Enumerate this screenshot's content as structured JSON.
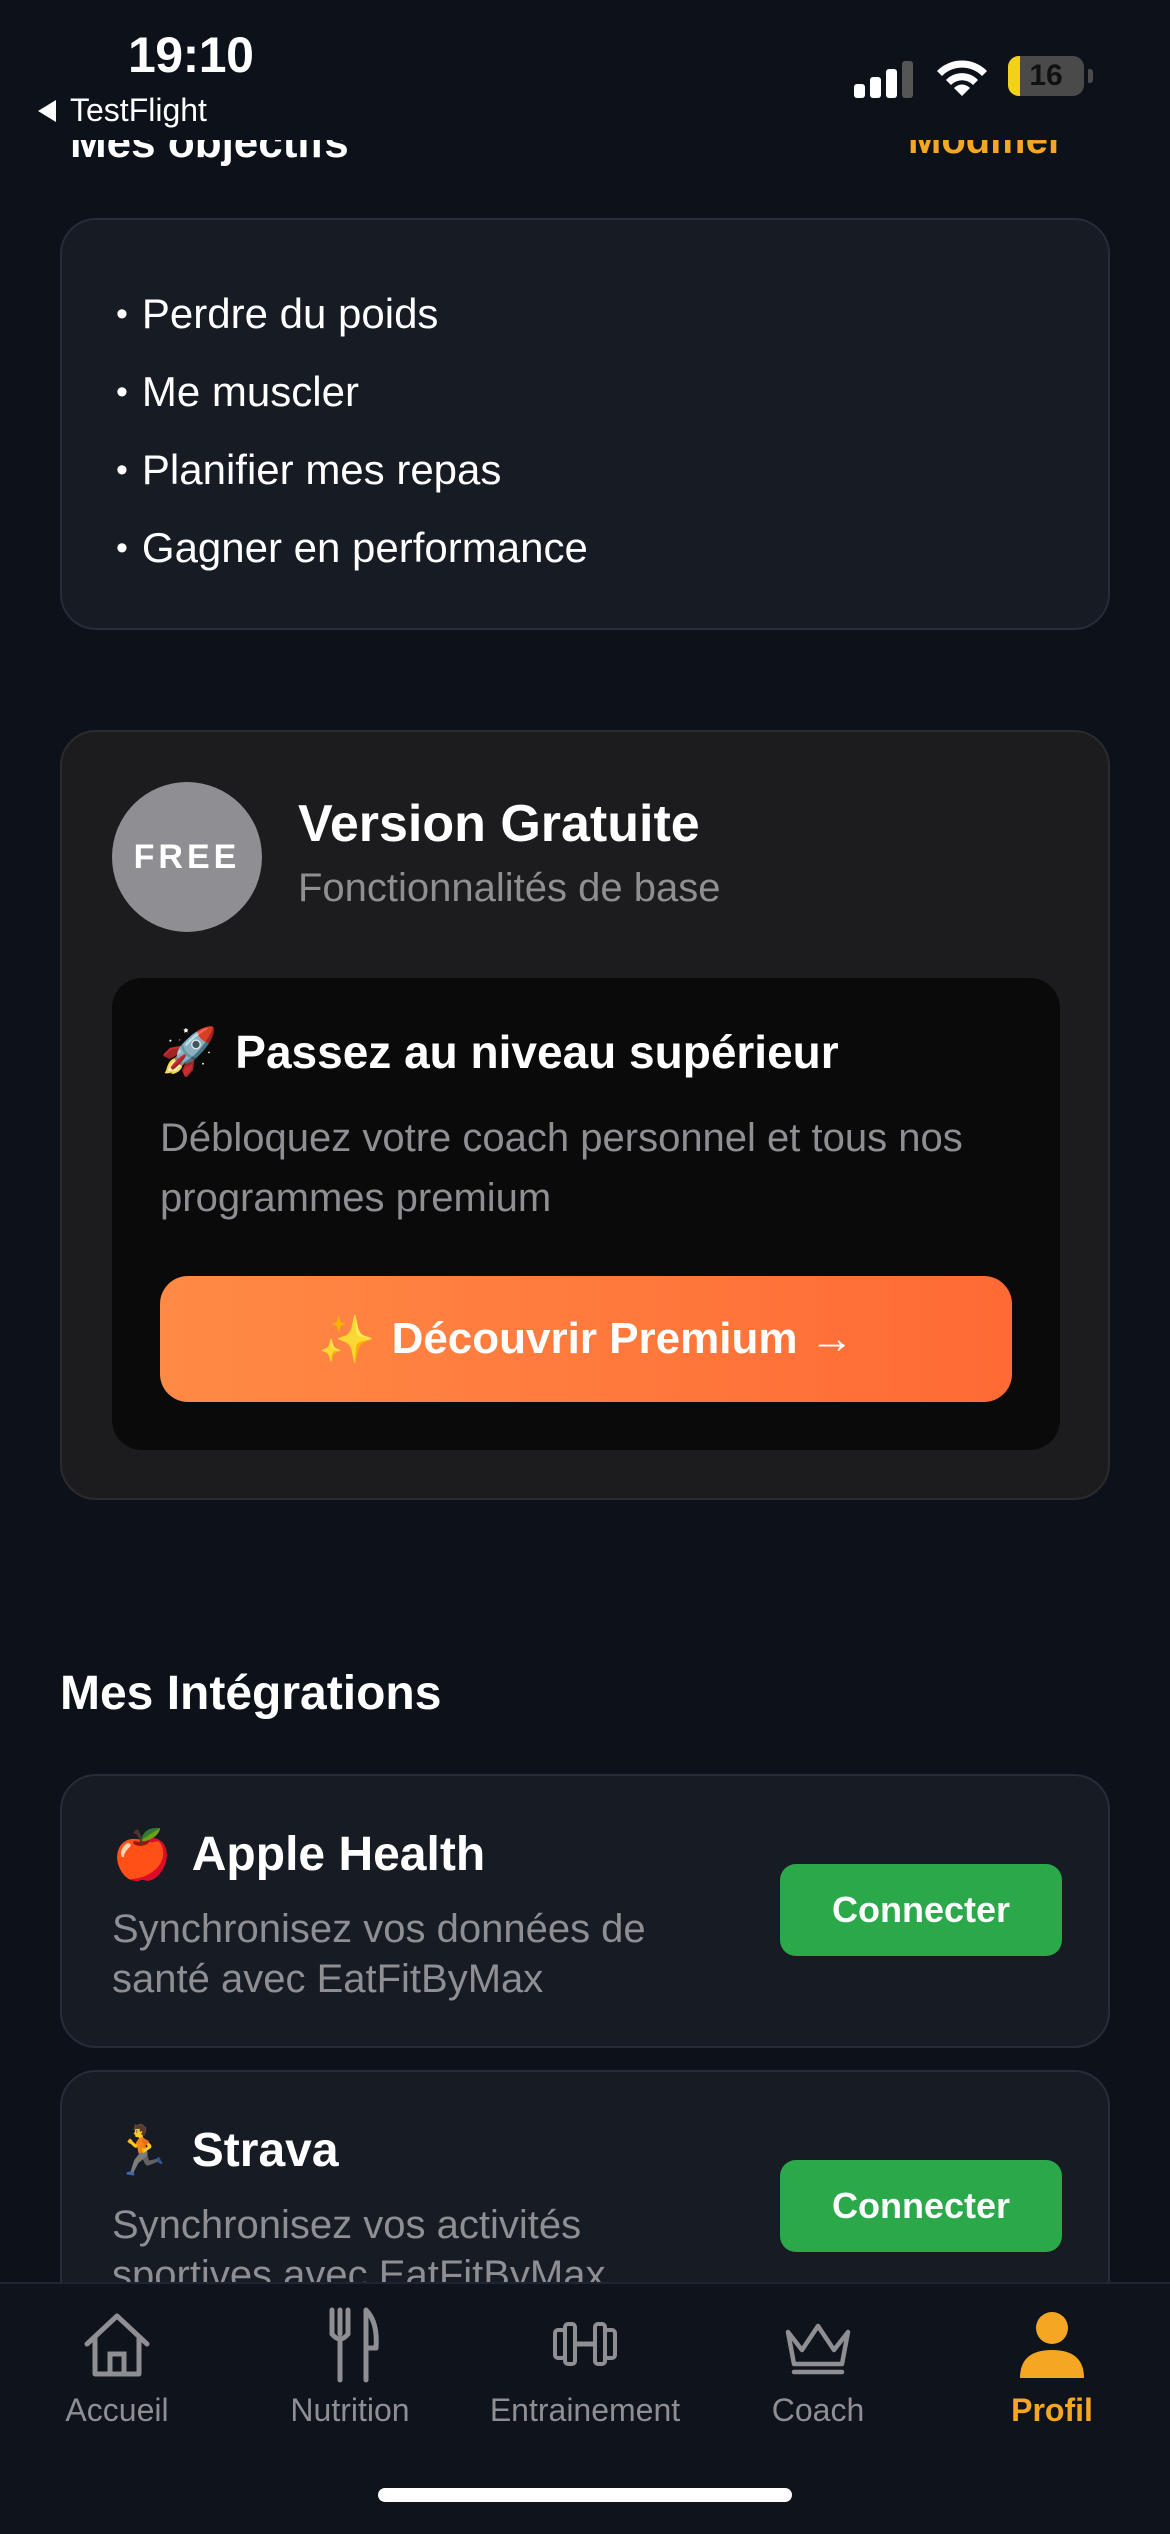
{
  "status_bar": {
    "time": "19:10",
    "back_app": "TestFlight",
    "battery_level": "16",
    "battery_fraction": 0.16
  },
  "goals_section": {
    "title": "Mes objectifs",
    "edit_label": "Modifier",
    "items": [
      "Perdre du poids",
      "Me muscler",
      "Planifier mes repas",
      "Gagner en performance"
    ]
  },
  "version": {
    "badge": "FREE",
    "title": "Version Gratuite",
    "subtitle": "Fonctionnalités de base",
    "upsell_emoji": "🚀",
    "upsell_title": "Passez au niveau supérieur",
    "upsell_desc": "Débloquez votre coach personnel et tous nos programmes premium",
    "premium_emoji": "✨",
    "premium_button": "Découvrir Premium →"
  },
  "integrations": {
    "title": "Mes Intégrations",
    "items": [
      {
        "emoji": "🍎",
        "name": "Apple Health",
        "desc": "Synchronisez vos données de santé avec EatFitByMax",
        "button": "Connecter"
      },
      {
        "emoji": "🏃",
        "name": "Strava",
        "desc": "Synchronisez vos activités sportives avec EatFitByMax",
        "button": "Connecter"
      }
    ]
  },
  "tab_bar": {
    "tabs": [
      "Accueil",
      "Nutrition",
      "Entrainement",
      "Coach",
      "Profil"
    ],
    "active": "Profil"
  },
  "colors": {
    "accent": "#f5a623",
    "background": "#0c111a",
    "connect": "#2ba84a",
    "premium": "#ff7a3d"
  }
}
